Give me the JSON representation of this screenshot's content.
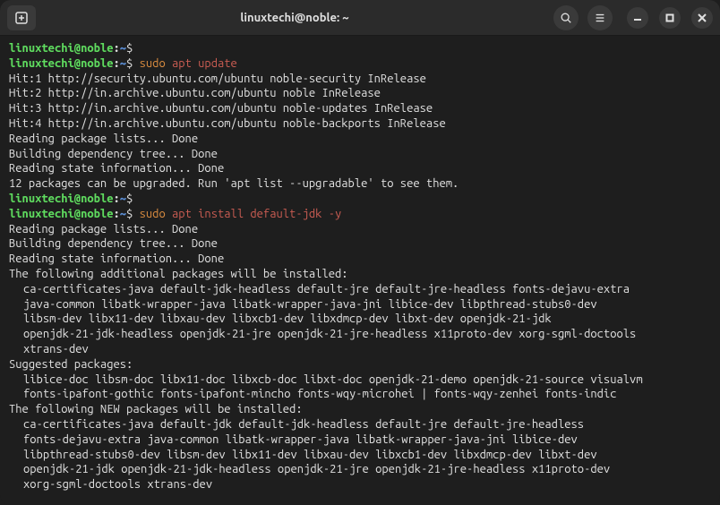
{
  "titlebar": {
    "title": "linuxtechi@noble: ~"
  },
  "prompt": {
    "user_host": "linuxtechi@noble",
    "colon": ":",
    "path": "~",
    "dollar": "$"
  },
  "commands": {
    "cmd1_sudo": "sudo ",
    "cmd1_rest": "apt update",
    "cmd2_sudo": "sudo ",
    "cmd2_rest": "apt install default-jdk -y"
  },
  "output": {
    "hit1": "Hit:1 http://security.ubuntu.com/ubuntu noble-security InRelease",
    "hit2": "Hit:2 http://in.archive.ubuntu.com/ubuntu noble InRelease",
    "hit3": "Hit:3 http://in.archive.ubuntu.com/ubuntu noble-updates InRelease",
    "hit4": "Hit:4 http://in.archive.ubuntu.com/ubuntu noble-backports InRelease",
    "reading_pkg_lists": "Reading package lists... Done",
    "building_dep_tree": "Building dependency tree... Done",
    "reading_state_info": "Reading state information... Done",
    "upgrade_msg": "12 packages can be upgraded. Run 'apt list --upgradable' to see them.",
    "reading_pkg_lists2": "Reading package lists... Done",
    "building_dep_tree2": "Building dependency tree... Done",
    "reading_state_info2": "Reading state information... Done",
    "additional_pkgs_header": "The following additional packages will be installed:",
    "add_pkg_line1": "ca-certificates-java default-jdk-headless default-jre default-jre-headless fonts-dejavu-extra",
    "add_pkg_line2": "java-common libatk-wrapper-java libatk-wrapper-java-jni libice-dev libpthread-stubs0-dev",
    "add_pkg_line3": "libsm-dev libx11-dev libxau-dev libxcb1-dev libxdmcp-dev libxt-dev openjdk-21-jdk",
    "add_pkg_line4": "openjdk-21-jdk-headless openjdk-21-jre openjdk-21-jre-headless x11proto-dev xorg-sgml-doctools",
    "add_pkg_line5": "xtrans-dev",
    "suggested_header": "Suggested packages:",
    "sugg_line1": "libice-doc libsm-doc libx11-doc libxcb-doc libxt-doc openjdk-21-demo openjdk-21-source visualvm",
    "sugg_line2": "fonts-ipafont-gothic fonts-ipafont-mincho fonts-wqy-microhei | fonts-wqy-zenhei fonts-indic",
    "new_pkgs_header": "The following NEW packages will be installed:",
    "new_line1": "ca-certificates-java default-jdk default-jdk-headless default-jre default-jre-headless",
    "new_line2": "fonts-dejavu-extra java-common libatk-wrapper-java libatk-wrapper-java-jni libice-dev",
    "new_line3": "libpthread-stubs0-dev libsm-dev libx11-dev libxau-dev libxcb1-dev libxdmcp-dev libxt-dev",
    "new_line4": "openjdk-21-jdk openjdk-21-jdk-headless openjdk-21-jre openjdk-21-jre-headless x11proto-dev",
    "new_line5": "xorg-sgml-doctools xtrans-dev"
  }
}
